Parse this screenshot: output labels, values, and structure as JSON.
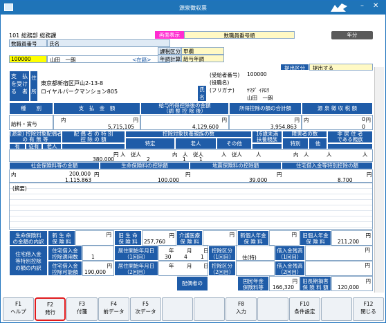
{
  "window": {
    "title": "源泉徴収票"
  },
  "header": {
    "dept": "101 総務部 総務課",
    "emp_no_label": "数職員番号",
    "name_label": "氏名",
    "screen_label": "画面表示",
    "screen_value": "数職員番号順",
    "year_button": "年分",
    "emp_no_value": "100000",
    "emp_name": "山田　一朗",
    "status": "<在籍>",
    "tax_class_label": "課税区分",
    "tax_class_value": "甲欄",
    "year_end_label": "年調計算",
    "year_end_value": "給与年調",
    "submit_label": "提出区分",
    "submit_value": "提出する"
  },
  "payee": {
    "label_payee": [
      "支",
      "払",
      "を",
      "受",
      "け",
      "る",
      "者"
    ],
    "label_address": [
      "住",
      "所"
    ],
    "address1": "東京都新宿区戸山2-13-8",
    "address2": "ロイヤルパークマンション805",
    "recv_no_label": "(受給者番号)",
    "recv_no": "100000",
    "post_label": "(役職名)",
    "name_label": [
      "氏",
      "名"
    ],
    "furigana_label": "(フリガナ)",
    "furigana": "ﾔﾏﾀﾞ ｲﾁﾛｳ",
    "name": "山田　一朗"
  },
  "main_table": {
    "headers": [
      "種　　別",
      "支　払　金　額",
      "給与所得控除後の金額\n（調 整 控 除 後）",
      "所得控除の額の合計額",
      "源 泉 徴 収 税 額"
    ],
    "type": "給料・賞与",
    "unit_yen": "円",
    "payment": "5,715,105",
    "after_deduction": "4,129,600",
    "deduction_total": "3,954,863",
    "tax_zero": "0",
    "tax": "0"
  },
  "dep_table": {
    "h1": "(源泉) 控除対象配偶者\nの 有 無 等",
    "h2": "配 偶 者 の 特 別\n控 除 の 額",
    "h3": "控除対象扶養親族の数",
    "h4": "16歳未満\n扶養親族",
    "h5": "障害者の数",
    "h6": "非 居 住 者\nである親族",
    "sub": [
      "有",
      "従有",
      "老人",
      "特定",
      "人",
      "従人",
      "内",
      "人",
      "従人",
      "その他",
      "人",
      "従人",
      "内",
      "特別",
      "他",
      "人"
    ],
    "spouse_amount": "380,000",
    "specific": "2",
    "elderly": "1",
    "elderly_inner": "1"
  },
  "ins_table": {
    "headers": [
      "社会保険料等の金額",
      "生命保険料の控除額",
      "地震保険料の控除額",
      "住宅借入金等特別控除の額"
    ],
    "inner": "200,000",
    "social": "1,115,863",
    "life": "100,000",
    "quake": "39,000",
    "housing": "8,700"
  },
  "remarks": {
    "label": "(摘要)"
  },
  "bottom": {
    "life_label": "生命保険料\nの金額の内訳",
    "new_life_label": "新 生 命\n保 険 料",
    "old_life_label": "旧 生 命\n保 険 料",
    "old_life": "257,760",
    "medical_label": "介護医療\n保 険 料",
    "new_pension_label": "新個人年金\n保 険 料",
    "old_pension_label": "旧個人年金\n保 険 料",
    "old_pension": "211,200",
    "housing_label": "住宅借入金\n等特別控除\nの額の内訳",
    "h_count_label": "住宅借入金\n控除適用数",
    "h_count": "1",
    "h_start1_label": "居住開始年月日\n（1回目）",
    "h_year1": "30",
    "h_month1": "4",
    "h_day1": "1",
    "h_class1_label": "控除区分\n（1回目）",
    "h_class1": "住(特)",
    "h_bal1_label": "借入金残高\n（1回目）",
    "h_avail_label": "住宅借入金\n控除可能額",
    "h_avail": "190,000",
    "h_start2_label": "居住開始年月日\n（2回目）",
    "h_class2_label": "控除区分\n（2回目）",
    "h_bal2_label": "借入金残高\n（2回目）",
    "spouse_label": "配偶者の",
    "nat_pension_label": "国民年金\n保険料等",
    "nat_pension": "166,320",
    "long_label": "旧長期損害\n保 険 料 額",
    "long": "120,000",
    "y": "年",
    "m": "月",
    "d": "日"
  },
  "fkeys": [
    {
      "key": "F1",
      "label": "ヘルプ"
    },
    {
      "key": "F2",
      "label": "発行"
    },
    {
      "key": "F3",
      "label": "付箋"
    },
    {
      "key": "F4",
      "label": "前データ"
    },
    {
      "key": "F5",
      "label": "次データ"
    },
    {
      "key": "F6",
      "label": ""
    },
    {
      "key": "F7",
      "label": ""
    },
    {
      "key": "F8",
      "label": "入力"
    },
    {
      "key": "F9",
      "label": ""
    },
    {
      "key": "F10",
      "label": "条件設定"
    },
    {
      "key": "F11",
      "label": ""
    },
    {
      "key": "F12",
      "label": "閉じる"
    }
  ]
}
